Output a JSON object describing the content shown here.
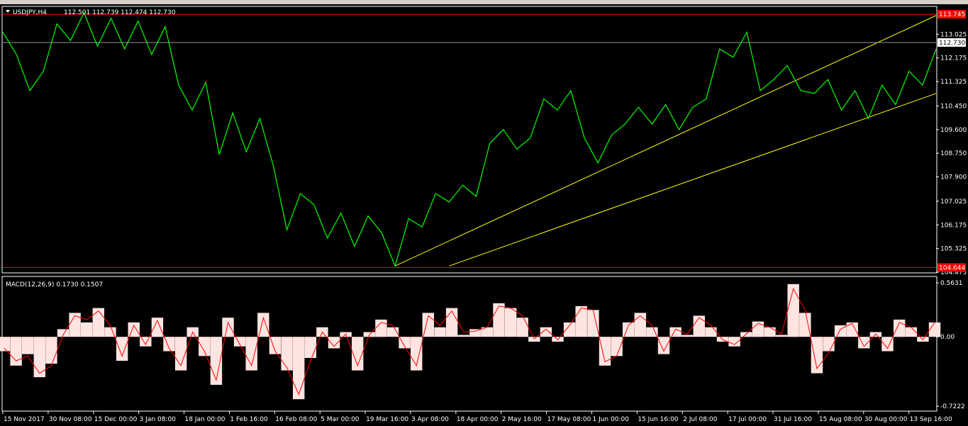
{
  "chart_data": [
    {
      "type": "line",
      "symbol": "USDJPY,H4",
      "ohlc_readout": "112.501 112.739 112.474 112.730",
      "colors": {
        "background": "#000000",
        "line": "#00ff00",
        "trendline": "#ffff00",
        "level_line": "#ff0000",
        "grid": "#ffffff"
      },
      "ylim": [
        104.475,
        113.875
      ],
      "y_ticks": [
        "113.025",
        "112.175",
        "111.325",
        "110.450",
        "109.600",
        "108.750",
        "107.900",
        "107.025",
        "106.175",
        "105.325",
        "104.475"
      ],
      "x_ticks": [
        "15 Nov 2017",
        "30 Nov 08:00",
        "15 Dec 00:00",
        "3 Jan 08:00",
        "18 Jan 00:00",
        "1 Feb 16:00",
        "16 Feb 08:00",
        "5 Mar 00:00",
        "19 Mar 16:00",
        "3 Apr 08:00",
        "18 Apr 00:00",
        "2 May 16:00",
        "17 May 08:00",
        "1 Jun 00:00",
        "15 Jun 16:00",
        "2 Jul 08:00",
        "17 Jul 00:00",
        "31 Jul 16:00",
        "15 Aug 08:00",
        "30 Aug 00:00",
        "13 Sep 16:00"
      ],
      "series": [
        {
          "values": [
            113.1,
            112.3,
            111.0,
            111.7,
            113.4,
            112.8,
            113.8,
            112.6,
            113.6,
            112.5,
            113.5,
            112.3,
            113.3,
            111.2,
            110.3,
            111.3,
            108.7,
            110.2,
            108.8,
            110.0,
            108.3,
            106.0,
            107.3,
            106.9,
            105.7,
            106.6,
            105.4,
            106.5,
            105.9,
            104.7,
            106.4,
            106.1,
            107.3,
            107.0,
            107.6,
            107.2,
            109.1,
            109.6,
            108.9,
            109.3,
            110.7,
            110.3,
            111.0,
            109.3,
            108.4,
            109.4,
            109.8,
            110.4,
            109.8,
            110.5,
            109.6,
            110.4,
            110.7,
            112.5,
            112.2,
            113.1,
            111.0,
            111.4,
            111.9,
            111.0,
            110.9,
            111.4,
            110.3,
            111.0,
            110.0,
            111.2,
            110.5,
            111.7,
            111.2,
            112.5
          ]
        }
      ],
      "hlines": [
        {
          "value": 113.745,
          "label": "113.745"
        },
        {
          "value": 104.644,
          "label": "104.644"
        }
      ],
      "price_line": {
        "value": 112.73,
        "label": "112.730"
      },
      "trendlines": [
        {
          "from": [
            29,
            104.7
          ],
          "to": [
            69,
            113.7
          ]
        },
        {
          "from": [
            33,
            104.7
          ],
          "to": [
            69,
            110.9
          ]
        }
      ]
    },
    {
      "type": "bar",
      "title": "MACD(12,26,9) 0.1730 0.1507",
      "ylim": [
        -0.7222,
        0.5631
      ],
      "y_ticks": [
        "0.5631",
        "0.00",
        "-0.7222"
      ],
      "colors": {
        "histogram": "#ffe4e1",
        "signal": "#ff0000"
      },
      "series": [
        {
          "name": "MACD",
          "values": [
            -0.15,
            -0.3,
            -0.18,
            -0.42,
            -0.28,
            0.08,
            0.25,
            0.15,
            0.3,
            0.1,
            -0.25,
            0.15,
            -0.1,
            0.2,
            -0.15,
            -0.35,
            0.1,
            -0.2,
            -0.5,
            0.2,
            -0.1,
            -0.35,
            0.25,
            -0.18,
            -0.35,
            -0.65,
            -0.22,
            0.1,
            -0.12,
            0.05,
            -0.35,
            0.05,
            0.18,
            0.1,
            -0.12,
            -0.35,
            0.25,
            0.1,
            0.3,
            0.02,
            0.08,
            0.1,
            0.35,
            0.3,
            0.2,
            -0.05,
            0.1,
            -0.05,
            0.15,
            0.32,
            0.28,
            -0.3,
            -0.2,
            0.15,
            0.25,
            0.1,
            -0.18,
            0.1,
            0.02,
            0.22,
            0.1,
            -0.05,
            -0.1,
            0.05,
            0.16,
            0.1,
            0.02,
            0.55,
            0.25,
            -0.38,
            -0.15,
            0.12,
            0.15,
            -0.12,
            0.05,
            -0.15,
            0.18,
            0.1,
            -0.05,
            0.15
          ]
        },
        {
          "name": "Signal",
          "values": [
            -0.12,
            -0.25,
            -0.2,
            -0.38,
            -0.3,
            0.02,
            0.22,
            0.18,
            0.27,
            0.12,
            -0.2,
            0.12,
            -0.08,
            0.17,
            -0.12,
            -0.3,
            0.05,
            -0.15,
            -0.45,
            0.15,
            -0.08,
            -0.3,
            0.2,
            -0.15,
            -0.32,
            -0.6,
            -0.25,
            0.05,
            -0.1,
            0.03,
            -0.3,
            0.02,
            0.15,
            0.12,
            -0.1,
            -0.3,
            0.22,
            0.12,
            0.27,
            0.05,
            0.06,
            0.1,
            0.32,
            0.3,
            0.22,
            -0.02,
            0.08,
            -0.03,
            0.12,
            0.3,
            0.28,
            -0.26,
            -0.2,
            0.12,
            0.22,
            0.12,
            -0.15,
            0.08,
            0.03,
            0.2,
            0.12,
            -0.03,
            -0.08,
            0.03,
            0.14,
            0.1,
            0.03,
            0.5,
            0.28,
            -0.33,
            -0.17,
            0.08,
            0.14,
            -0.1,
            0.03,
            -0.12,
            0.15,
            0.1,
            -0.03,
            0.15
          ]
        }
      ]
    }
  ]
}
